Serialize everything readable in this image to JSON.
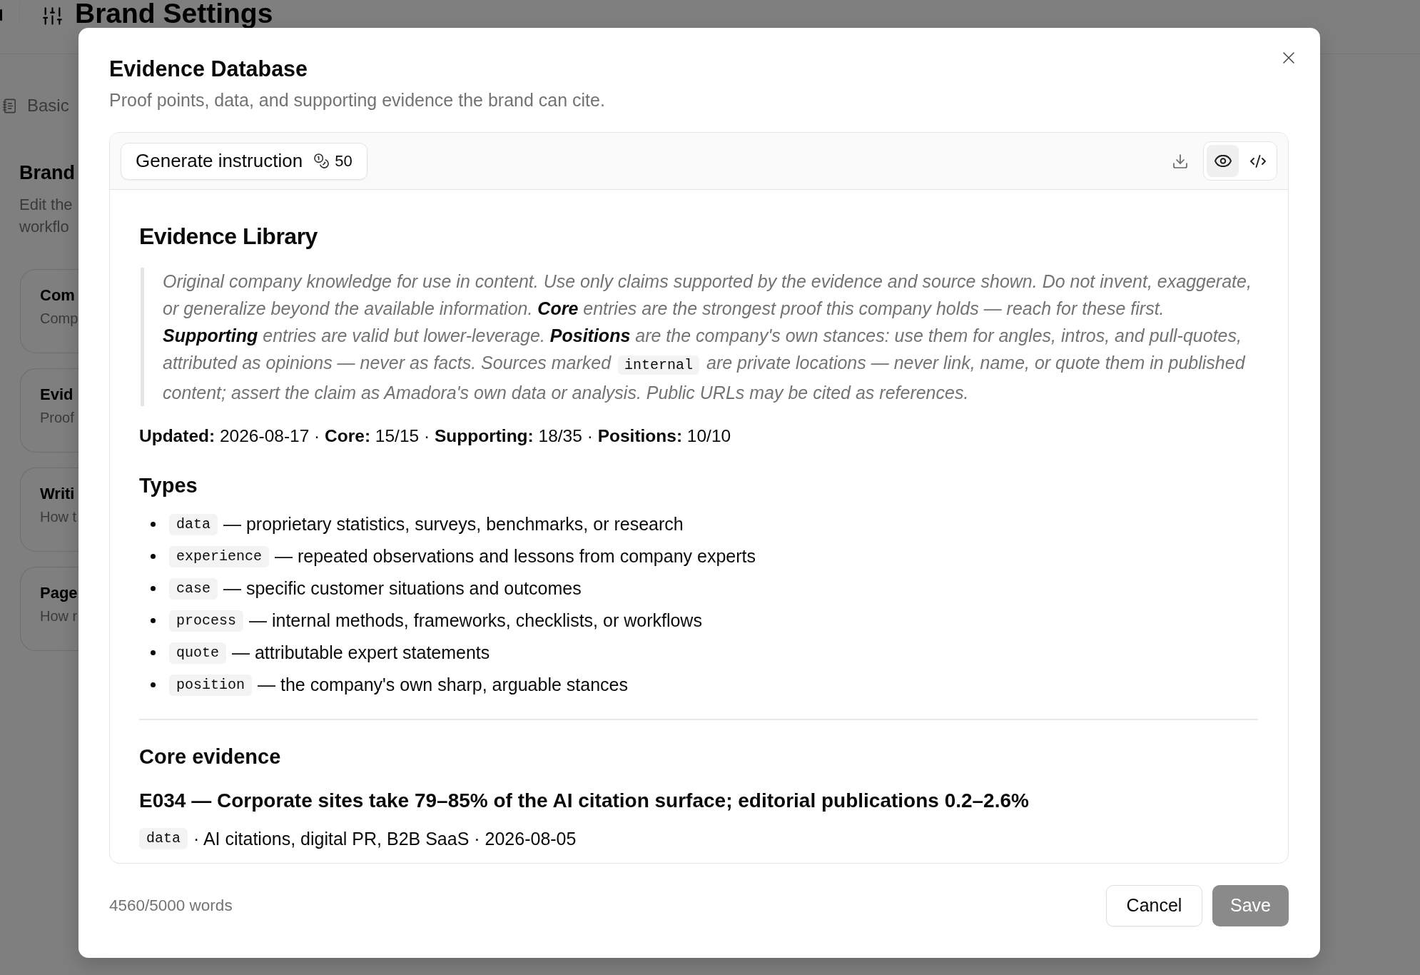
{
  "background_page": {
    "title": "Brand Settings",
    "tab": "Basic",
    "section_title": "Brand",
    "section_description_lines": [
      "Edit the",
      "workflo"
    ],
    "cards": [
      {
        "title": "Com",
        "subtitle": "Comp"
      },
      {
        "title": "Evid",
        "subtitle": "Proof"
      },
      {
        "title": "Writi",
        "subtitle": "How t"
      },
      {
        "title": "Page",
        "subtitle": "How r"
      }
    ]
  },
  "dialog": {
    "title": "Evidence Database",
    "subtitle": "Proof points, data, and supporting evidence the brand can cite.",
    "toolbar": {
      "generate_button": {
        "label": "Generate instruction",
        "cost": "50"
      },
      "view_modes": [
        {
          "kind": "preview",
          "selected": true
        },
        {
          "kind": "code",
          "selected": false
        }
      ]
    },
    "document": {
      "heading": "Evidence Library",
      "intro": [
        {
          "kind": "text",
          "text": "Original company knowledge for use in content. Use only claims supported by the evidence and source shown. Do not invent, exaggerate, or generalize beyond the available information. **Core** entries are the strongest proof this company holds — reach for these first. **Supporting** entries are valid but lower-leverage. **Positions** are the company's own stances: use them for angles, intros, and pull-quotes, attributed as opinions — never as facts. Sources marked "
        },
        {
          "kind": "code",
          "text": "internal"
        },
        {
          "kind": "text",
          "text": " are private locations — never link, name, or quote them in published content; assert the claim as Amadora's own data or analysis. Public URLs may be cited as references."
        }
      ],
      "summary": "**Updated:** 2026-08-17 · **Core:** 15/15 · **Supporting:** 18/35 · **Positions:** 10/10",
      "types_heading": "Types",
      "types": [
        {
          "code": "data",
          "description": "— proprietary statistics, surveys, benchmarks, or research"
        },
        {
          "code": "experience",
          "description": "— repeated observations and lessons from company experts"
        },
        {
          "code": "case",
          "description": "— specific customer situations and outcomes"
        },
        {
          "code": "process",
          "description": "— internal methods, frameworks, checklists, or workflows"
        },
        {
          "code": "quote",
          "description": "— attributable expert statements"
        },
        {
          "code": "position",
          "description": "— the company's own sharp, arguable stances"
        }
      ],
      "core_heading": "Core evidence",
      "entries": [
        {
          "title": "E034 — Corporate sites take 79–85% of the AI citation surface; editorial publications 0.2–2.6%",
          "type": "data",
          "meta": "· AI citations, digital PR, B2B SaaS · 2026-08-05"
        }
      ]
    },
    "word_count": "4560/5000 words",
    "buttons": [
      {
        "label": "Cancel",
        "kind": "secondary",
        "disabled": false
      },
      {
        "label": "Save",
        "kind": "primary",
        "disabled": true
      }
    ]
  }
}
